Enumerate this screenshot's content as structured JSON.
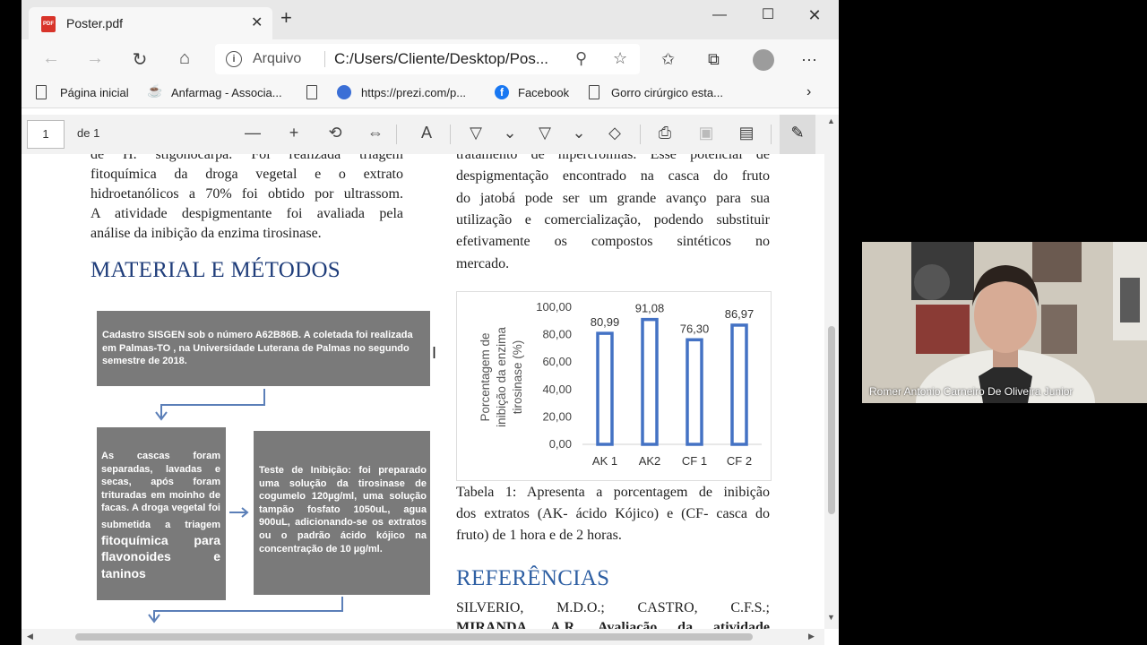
{
  "tab": {
    "title": "Poster.pdf",
    "pdf_badge": "PDF"
  },
  "address": {
    "label": "Arquivo",
    "url": "C:/Users/Cliente/Desktop/Pos..."
  },
  "favorites": [
    {
      "label": "Página inicial"
    },
    {
      "label": "Anfarmag - Associa..."
    },
    {
      "label": "https://prezi.com/p..."
    },
    {
      "label": "Facebook"
    },
    {
      "label": "Gorro cirúrgico esta..."
    }
  ],
  "pdf_toolbar": {
    "page": "1",
    "of_label": "de 1"
  },
  "document": {
    "left_intro": [
      {
        "text": "de H. stigonocarpa. Foi realizada triagem",
        "justify": true
      },
      {
        "text": "fitoquímica da droga vegetal e o extrato",
        "justify": true
      },
      {
        "text": "hidroetanólicos a 70% foi obtido por ultrassom.",
        "justify": true
      },
      {
        "text": "A atividade despigmentante foi avaliada pela",
        "justify": true
      },
      {
        "text": "análise da inibição da enzima tirosinase.",
        "justify": false
      }
    ],
    "methods_heading": "MATERIAL E MÉTODOS",
    "box1": "Cadastro SISGEN sob o número A62B86B. A coletada foi realizada em Palmas-TO , na Universidade Luterana de Palmas no segundo semestre de 2018.",
    "box2_small": "As cascas foram separadas, lavadas e secas, após foram trituradas em moinho de facas. A droga vegetal foi submetida a triagem",
    "box2_large": " fitoquímica para flavonoides e taninos",
    "box3": "Teste de Inibição: foi preparado uma solução da tirosinase de cogumelo 120µg/ml, uma solução tampão fosfato 1050uL, agua 900uL, adicionando-se os extratos ou o padrão ácido kójico na concentração de 10 µg/ml.",
    "right_intro": [
      {
        "text": "tratamento de hipercromias. Esse potencial de",
        "justify": true
      },
      {
        "text": "despigmentação encontrado na casca do fruto",
        "justify": true
      },
      {
        "text": "do jatobá pode ser um grande avanço para sua",
        "justify": true
      },
      {
        "text": "utilização e comercialização, podendo substituir",
        "justify": true
      },
      {
        "text": "efetivamente os compostos sintéticos no",
        "justify": true
      },
      {
        "text": "mercado.",
        "justify": false
      }
    ],
    "caption": [
      {
        "text": "Tabela 1: Apresenta a porcentagem de inibição",
        "justify": true
      },
      {
        "text": "dos extratos (AK- ácido Kójico) e (CF- casca do",
        "justify": true
      },
      {
        "text": "fruto) de 1 hora e de 2 horas.",
        "justify": false
      }
    ],
    "refs_heading": "REFERÊNCIAS",
    "refs_line1": "SILVERIO, M.D.O.; CASTRO, C.F.S.;",
    "refs_line2": "MIRANDA, A.R. Avaliação da atividade"
  },
  "chart_data": {
    "type": "bar",
    "categories": [
      "AK 1",
      "AK2",
      "CF 1",
      "CF 2"
    ],
    "values": [
      80.99,
      91.08,
      76.3,
      86.97
    ],
    "value_labels": [
      "80,99",
      "91,08",
      "76,30",
      "86,97"
    ],
    "ylabel_lines": [
      "Porcentagem de",
      "inibição da enzima",
      "tirosinase (%)"
    ],
    "ylim": [
      0,
      100
    ],
    "yticks": [
      "0,00",
      "20,00",
      "40,00",
      "60,00",
      "80,00",
      "100,00"
    ],
    "bar_color": "#4472c4",
    "grid": false
  },
  "webcam": {
    "name": "Romer Antonio Carneiro De Oliveira Junior"
  }
}
